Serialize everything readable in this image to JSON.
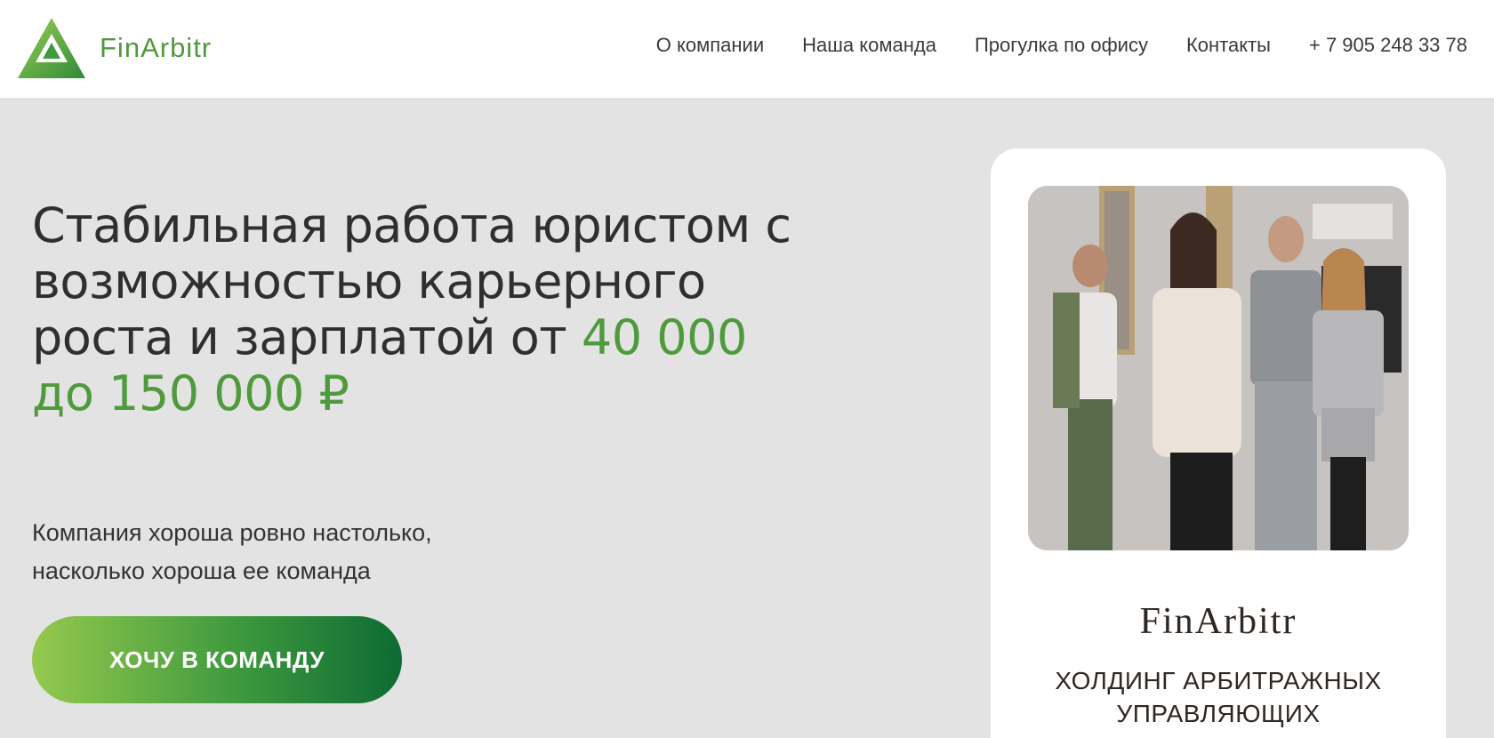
{
  "header": {
    "logo_text": "FinArbitr",
    "nav": [
      {
        "label": "О компании"
      },
      {
        "label": "Наша команда"
      },
      {
        "label": "Прогулка по офису"
      },
      {
        "label": "Контакты"
      },
      {
        "label": "+ 7 905 248 33 78"
      }
    ]
  },
  "hero": {
    "title_main": "Стабильная работа юристом с возможностью карьерного роста и зарплатой от",
    "title_accent": "40 000 до 150 000 ₽",
    "subtitle": "Компания хороша ровно настолько, насколько хороша ее команда",
    "cta_label": "ХОЧУ В КОМАНДУ"
  },
  "card": {
    "logo_text": "FinArbitr",
    "tagline": "ХОЛДИНГ АРБИТРАЖНЫХ УПРАВЛЯЮЩИХ"
  },
  "colors": {
    "accent": "#4f9a3c",
    "background": "#e3e3e3",
    "cta_gradient_start": "#95c94e",
    "cta_gradient_end": "#0d6b34"
  }
}
